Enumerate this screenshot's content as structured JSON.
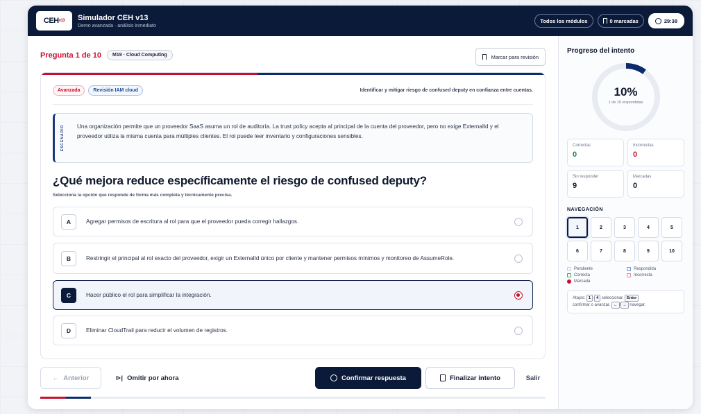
{
  "header": {
    "logo_text": "CEH",
    "logo_sup": "v13",
    "title": "Simulador CEH v13",
    "subtitle": "Demo avanzada · análisis inmediato",
    "modules_label": "Todos los módulos",
    "marked_label": "0 marcadas",
    "timer": "29:38"
  },
  "question": {
    "counter": "Pregunta 1 de 10",
    "module": "M19 · Cloud Computing",
    "mark_label": "Marcar para revisión",
    "progress_fraction": 0.43,
    "tags": [
      "Avanzada",
      "Revisión IAM cloud"
    ],
    "objective": "Identificar y mitigar riesgo de confused deputy en confianza entre cuentas.",
    "scenario_label": "ESCENARIO",
    "scenario": "Una organización permite que un proveedor SaaS asuma un rol de auditoría. La trust policy acepta al principal de la cuenta del proveedor, pero no exige ExternalId y el proveedor utiliza la misma cuenta para múltiples clientes. El rol puede leer inventario y configuraciones sensibles.",
    "text": "¿Qué mejora reduce específicamente el riesgo de confused deputy?",
    "hint": "Selecciona la opción que responde de forma más completa y técnicamente precisa.",
    "options": [
      {
        "key": "A",
        "text": "Agregar permisos de escritura al rol para que el proveedor pueda corregir hallazgos."
      },
      {
        "key": "B",
        "text": "Restringir el principal al rol exacto del proveedor, exigir un ExternalId único por cliente y mantener permisos mínimos y monitoreo de AssumeRole."
      },
      {
        "key": "C",
        "text": "Hacer público el rol para simplificar la integración."
      },
      {
        "key": "D",
        "text": "Eliminar CloudTrail para reducir el volumen de registros."
      }
    ],
    "selected": "C"
  },
  "footer": {
    "prev": "Anterior",
    "skip": "Omitir por ahora",
    "confirm": "Confirmar respuesta",
    "finish": "Finalizar intento",
    "exit": "Salir",
    "progress_fraction": 0.1
  },
  "sidebar": {
    "title": "Progreso del intento",
    "percent": "10%",
    "percent_value": 0.1,
    "percent_sub": "1 de 10 respondidas",
    "stats": [
      {
        "label": "Correctas",
        "value": "0"
      },
      {
        "label": "Incorrectas",
        "value": "0"
      },
      {
        "label": "Sin responder",
        "value": "9"
      },
      {
        "label": "Marcadas",
        "value": "0"
      }
    ],
    "nav_title": "NAVEGACIÓN",
    "nav_items": [
      "1",
      "2",
      "3",
      "4",
      "5",
      "6",
      "7",
      "8",
      "9",
      "10"
    ],
    "current": "1",
    "legend": [
      "Pendiente",
      "Respondida",
      "Correcta",
      "Incorrecta",
      "Marcada"
    ],
    "shortcuts": {
      "t1": "Atajos:",
      "k1": "1",
      "k2": "4",
      "t2": "seleccionar,",
      "k3": "Enter",
      "t3": "confirmar o avanzar,",
      "k4": "←",
      "k5": "→",
      "t4": "navegar."
    }
  },
  "colors": {
    "navy": "#0c1a3a",
    "accent_red": "#c8102e",
    "correct_green": "#138a48"
  }
}
